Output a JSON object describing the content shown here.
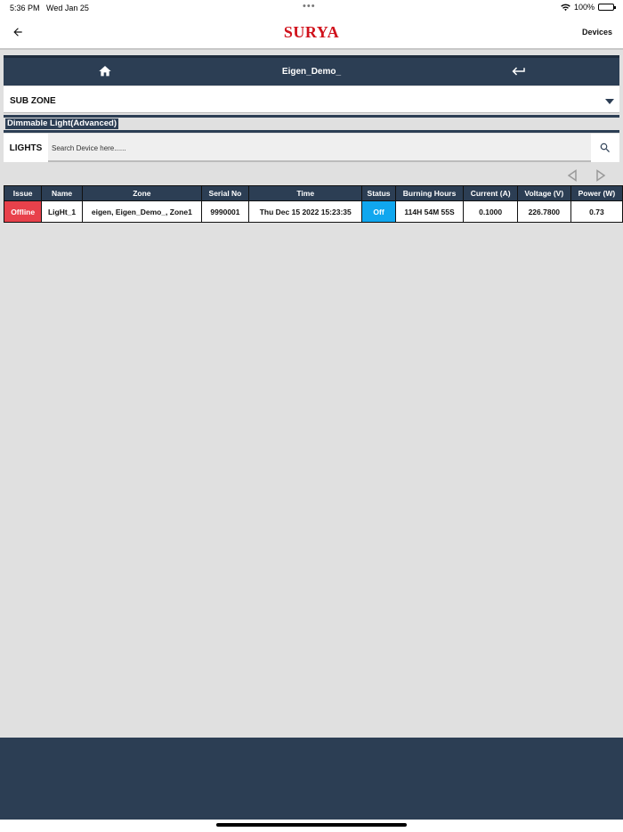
{
  "status_bar": {
    "time": "5:36 PM",
    "date": "Wed Jan 25",
    "battery": "100%"
  },
  "header": {
    "brand": "SURYA",
    "devices_link": "Devices"
  },
  "navbar": {
    "title": "Eigen_Demo_"
  },
  "subzone": {
    "label": "SUB ZONE"
  },
  "device_type": "Dimmable Light(Advanced)",
  "search": {
    "category": "LIGHTS",
    "placeholder": "Search Device here......"
  },
  "table": {
    "columns": [
      "Issue",
      "Name",
      "Zone",
      "Serial No",
      "Time",
      "Status",
      "Burning Hours",
      "Current (A)",
      "Voltage (V)",
      "Power (W)"
    ],
    "rows": [
      [
        "Offline",
        "LigHt_1",
        "eigen, Eigen_Demo_, Zone1",
        "9990001",
        "Thu Dec 15 2022 15:23:35",
        "Off",
        "114H 54M 55S",
        "0.1000",
        "226.7800",
        "0.73"
      ]
    ]
  },
  "colors": {
    "navy": "#2c3e54",
    "brand_red": "#d0111b",
    "issue_red": "#e8414b",
    "status_blue": "#10a7ef"
  },
  "icons": {
    "back": "arrow-left-icon",
    "home": "home-icon",
    "return": "return-icon",
    "dropdown": "caret-down-icon",
    "search": "search-icon",
    "prev": "triangle-left-icon",
    "next": "triangle-right-icon"
  }
}
